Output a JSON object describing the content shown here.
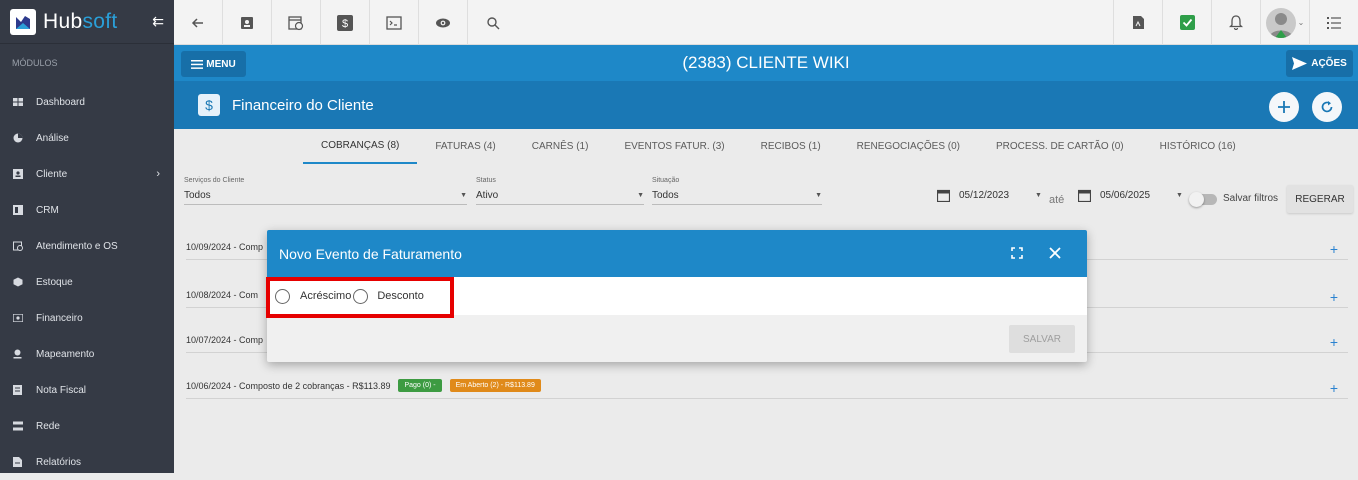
{
  "app": {
    "logo_text_a": "Hub",
    "logo_text_b": "soft",
    "collapse_icon": "collapse-arrow-icon"
  },
  "sidebar": {
    "section_title": "MÓDULOS",
    "items": [
      {
        "label": "Dashboard",
        "icon": "dashboard-icon"
      },
      {
        "label": "Análise",
        "icon": "pie-chart-icon"
      },
      {
        "label": "Cliente",
        "icon": "client-icon"
      },
      {
        "label": "CRM",
        "icon": "crm-icon"
      },
      {
        "label": "Atendimento e OS",
        "icon": "calendar-clock-icon"
      },
      {
        "label": "Estoque",
        "icon": "box-icon"
      },
      {
        "label": "Financeiro",
        "icon": "money-icon"
      },
      {
        "label": "Mapeamento",
        "icon": "map-pin-icon"
      },
      {
        "label": "Nota Fiscal",
        "icon": "invoice-icon"
      },
      {
        "label": "Rede",
        "icon": "network-icon"
      },
      {
        "label": "Relatórios",
        "icon": "report-icon"
      }
    ]
  },
  "client_bar": {
    "title": "(2383) CLIENTE WIKI",
    "menu_label": "MENU",
    "acoes_label": "AÇÕES"
  },
  "section": {
    "title": "Financeiro do Cliente",
    "icon_glyph": "$"
  },
  "tabs": [
    {
      "label": "COBRANÇAS (8)",
      "active": true
    },
    {
      "label": "FATURAS (4)"
    },
    {
      "label": "CARNÊS (1)"
    },
    {
      "label": "EVENTOS FATUR. (3)"
    },
    {
      "label": "RECIBOS (1)"
    },
    {
      "label": "RENEGOCIAÇÕES (0)"
    },
    {
      "label": "PROCESS. DE CARTÃO (0)"
    },
    {
      "label": "HISTÓRICO (16)"
    }
  ],
  "filters": {
    "servicos": {
      "label": "Serviços do Cliente",
      "value": "Todos"
    },
    "status": {
      "label": "Status",
      "value": "Ativo"
    },
    "situacao": {
      "label": "Situação",
      "value": "Todos"
    },
    "date_from": "05/12/2023",
    "date_sep": "até",
    "date_to": "05/06/2025",
    "salvar_filtros": "Salvar filtros",
    "regerar": "REGERAR"
  },
  "list": [
    {
      "text": "10/09/2024 - Comp"
    },
    {
      "text": "10/08/2024 - Com"
    },
    {
      "text": "10/07/2024 - Comp"
    },
    {
      "text": "10/06/2024 - Composto de 2 cobranças - R$113.89",
      "badge_paid": "Pago (0) -",
      "badge_open": "Em Aberto (2) - R$113.89"
    }
  ],
  "dialog": {
    "title": "Novo Evento de Faturamento",
    "option_a": "Acréscimo",
    "option_b": "Desconto",
    "save_label": "SALVAR"
  },
  "colors": {
    "sidebar": "#353a45",
    "primary": "#1e88c8",
    "primary_dark": "#1a78b5",
    "highlight": "#e60000",
    "paid": "#3d9b42",
    "open": "#e08a1a"
  }
}
